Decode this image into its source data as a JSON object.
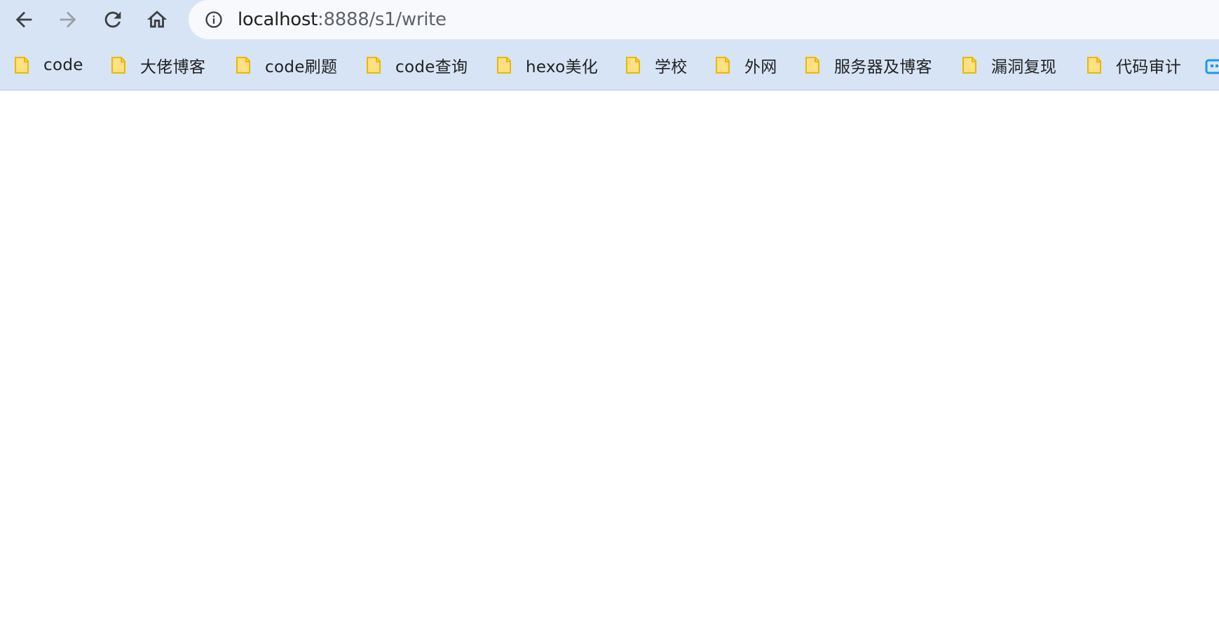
{
  "browser": {
    "url_host": "localhost",
    "url_rest": ":8888/s1/write"
  },
  "icons": {
    "back": "arrow-left-icon",
    "forward": "arrow-right-icon",
    "reload": "reload-icon",
    "home": "home-icon",
    "site_info": "info-circle-icon",
    "bookmark_folder": "folder-icon",
    "overflow_app": "app-shortcut-icon"
  },
  "colors": {
    "chrome_background": "#d7e4f5",
    "omnibox_background": "#f7f9fc",
    "folder_fill": "#ffe082",
    "folder_stroke": "#e9b800",
    "icon_dark": "#3c4043",
    "icon_disabled": "#9aa0a6",
    "app_icon": "#1a9be6"
  },
  "bookmarks": [
    {
      "label": "code"
    },
    {
      "label": "大佬博客"
    },
    {
      "label": "code刷题"
    },
    {
      "label": "code查询"
    },
    {
      "label": "hexo美化"
    },
    {
      "label": "学校"
    },
    {
      "label": "外网"
    },
    {
      "label": "服务器及博客"
    },
    {
      "label": "漏洞复现"
    },
    {
      "label": "代码审计"
    }
  ]
}
